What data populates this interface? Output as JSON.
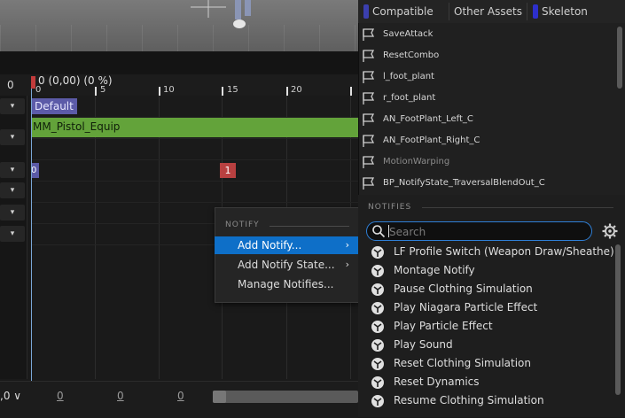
{
  "timeline": {
    "frame_number": "0",
    "readout": "0 (0,00) (0 %)",
    "ticks": [
      "0",
      "5",
      "10",
      "15",
      "20"
    ],
    "default_label": "Default",
    "montage_name": "MM_Pistol_Equip",
    "marker_left": "0",
    "marker_1": "1",
    "left_dropdowns": [
      "▾",
      "▾",
      "▾",
      "▾",
      "▾",
      "▾"
    ],
    "bottom_comma": ",0 ∨",
    "bottom_zeros": [
      "0",
      "0",
      "0"
    ]
  },
  "context_menu": {
    "heading": "NOTIFY",
    "items": [
      {
        "label": "Add Notify...",
        "arrow": "›"
      },
      {
        "label": "Add Notify State...",
        "arrow": "›"
      },
      {
        "label": "Manage Notifies...",
        "arrow": ""
      }
    ]
  },
  "filters": [
    {
      "label": "Compatible",
      "color": "#3b3fae"
    },
    {
      "label": "Other Assets",
      "color": "#3a3a3a"
    },
    {
      "label": "Skeleton",
      "color": "#2d2fcc"
    }
  ],
  "skeleton_notifies": [
    "SaveAttack",
    "ResetCombo",
    "l_foot_plant",
    "r_foot_plant",
    "AN_FootPlant_Left_C",
    "AN_FootPlant_Right_C",
    "MotionWarping",
    "BP_NotifyState_TraversalBlendOut_C"
  ],
  "notifies_section": {
    "heading": "NOTIFIES",
    "search_placeholder": "Search",
    "items": [
      "LF Profile Switch (Weapon Draw/Sheathe)",
      "Montage Notify",
      "Pause Clothing Simulation",
      "Play Niagara Particle Effect",
      "Play Particle Effect",
      "Play Sound",
      "Reset Clothing Simulation",
      "Reset Dynamics",
      "Resume Clothing Simulation"
    ]
  },
  "colors": {
    "accent": "#0e6fc8",
    "montage_green": "#63a33a",
    "default_purple": "#5c5ba8",
    "marker_red": "#b84040"
  }
}
